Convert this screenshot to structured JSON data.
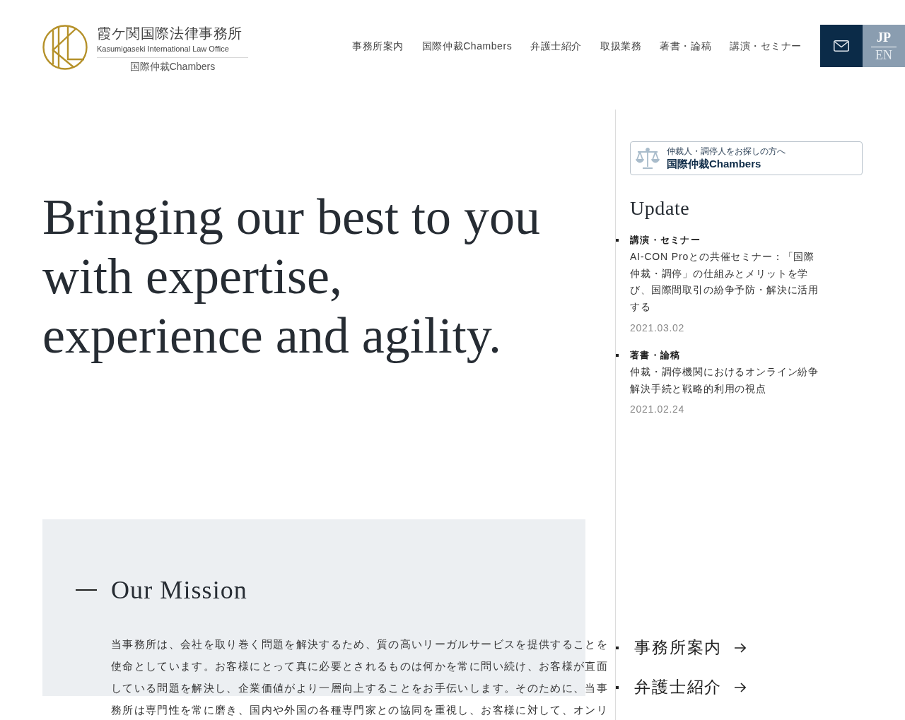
{
  "header": {
    "logo": {
      "name": "霞ケ関国際法律事務所",
      "name_en": "Kasumigaseki International Law Office",
      "sub": "国際仲裁Chambers"
    },
    "nav": [
      "事務所案内",
      "国際仲裁Chambers",
      "弁護士紹介",
      "取扱業務",
      "著書・論稿",
      "講演・セミナー"
    ],
    "languages": [
      {
        "label": "JP",
        "selected": true
      },
      {
        "label": "EN",
        "selected": false
      }
    ]
  },
  "hero": {
    "headline": "Bringing our best to you with expertise, experience and agility."
  },
  "mission": {
    "title": "Our Mission",
    "text": "当事務所は、会社を取り巻く問題を解決するため、質の高いリーガルサービスを提供することを使命としています。お客様にとって真に必要とされるものは何かを常に問い続け、お客様が直面している問題を解決し、企業価値がより一層向上することをお手伝いします。そのために、当事務所は専門性を常に磨き、国内や外国の各種専門家との協同を重視し、お客様に対して、オンリ"
  },
  "sidebar": {
    "banner": {
      "caption": "仲裁人・調停人をお探しの方へ",
      "title": "国際仲裁Chambers"
    },
    "update": {
      "title": "Update",
      "items": [
        {
          "category": "講演・セミナー",
          "title": "AI-CON Proとの共催セミナー：「国際仲裁・調停」の仕組みとメリットを学び、国際間取引の紛争予防・解決に活用する",
          "date": "2021.03.02"
        },
        {
          "category": "著書・論稿",
          "title": "仲裁・調停機関におけるオンライン紛争解決手続と戦略的利用の視点",
          "date": "2021.02.24"
        }
      ]
    },
    "links": [
      "事務所案内",
      "弁護士紹介"
    ]
  }
}
